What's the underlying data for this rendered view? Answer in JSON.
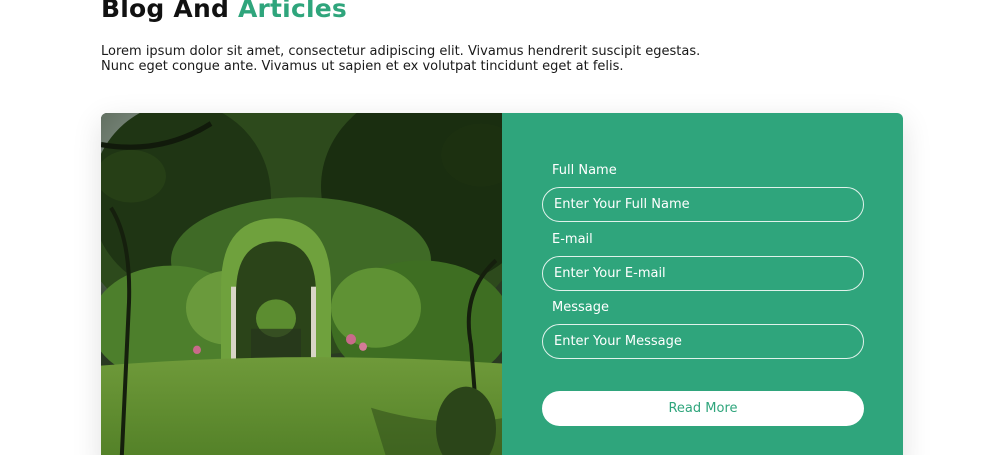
{
  "section": {
    "title_prefix": "Blog And",
    "title_accent": "Articles",
    "intro": "Lorem ipsum dolor sit amet, consectetur adipiscing elit. Vivamus hendrerit suscipit egestas. Nunc eget congue ante. Vivamus ut sapien et ex volutpat tincidunt eget at felis."
  },
  "form": {
    "full_name_label": "Full Name",
    "full_name_placeholder": "Enter Your Full Name",
    "email_label": "E-mail",
    "email_placeholder": "Enter Your E-mail",
    "message_label": "Message",
    "message_placeholder": "Enter Your Message",
    "submit_label": "Read More"
  },
  "colors": {
    "accent": "#2fa57c",
    "text": "#111111",
    "button_bg": "#ffffff"
  }
}
